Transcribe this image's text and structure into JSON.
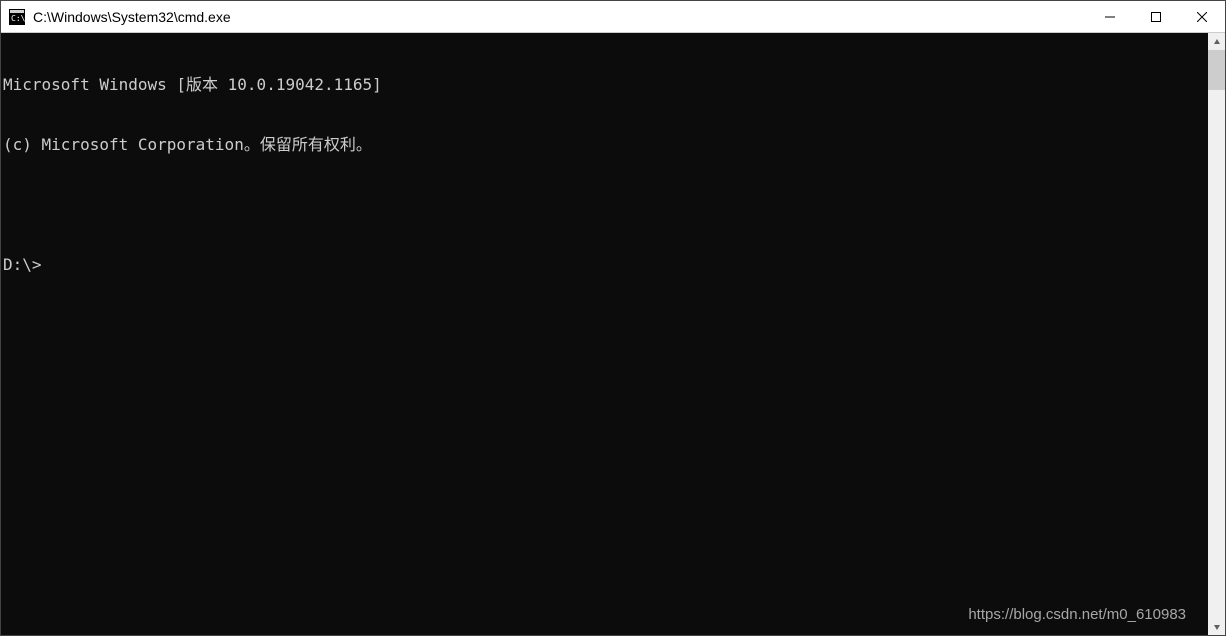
{
  "window": {
    "title": "C:\\Windows\\System32\\cmd.exe"
  },
  "terminal": {
    "lines": [
      "Microsoft Windows [版本 10.0.19042.1165]",
      "(c) Microsoft Corporation。保留所有权利。",
      "",
      "D:\\>"
    ]
  },
  "watermark": "https://blog.csdn.net/m0_610983"
}
